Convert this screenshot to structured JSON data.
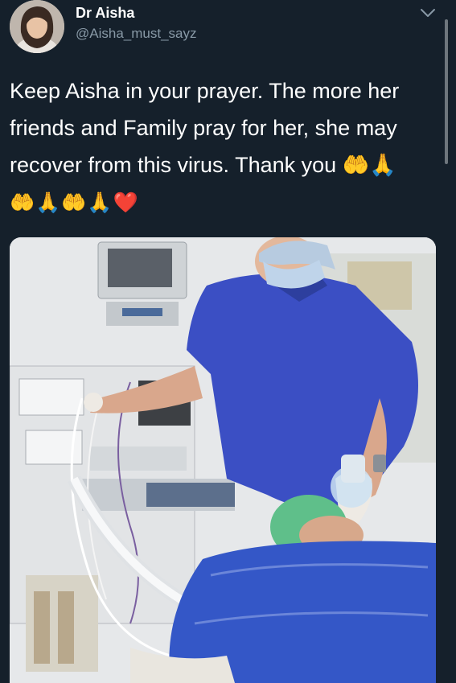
{
  "header": {
    "display_name": "Dr Aisha",
    "handle": "@Aisha_must_sayz",
    "avatar_icon": "profile-photo",
    "menu_icon": "chevron-down-icon"
  },
  "tweet": {
    "line1": "Keep Aisha in your prayer.  The more her",
    "line2": "friends and Family pray for her, she may",
    "line3": "recover from this virus.  Thank you 🤲🙏",
    "line4": "🤲🙏🤲🙏❤️"
  },
  "media": {
    "alt": "photo"
  },
  "colors": {
    "background": "#15202b",
    "secondary_text": "#8899a6",
    "scrub_blue": "#3b4fc4"
  }
}
